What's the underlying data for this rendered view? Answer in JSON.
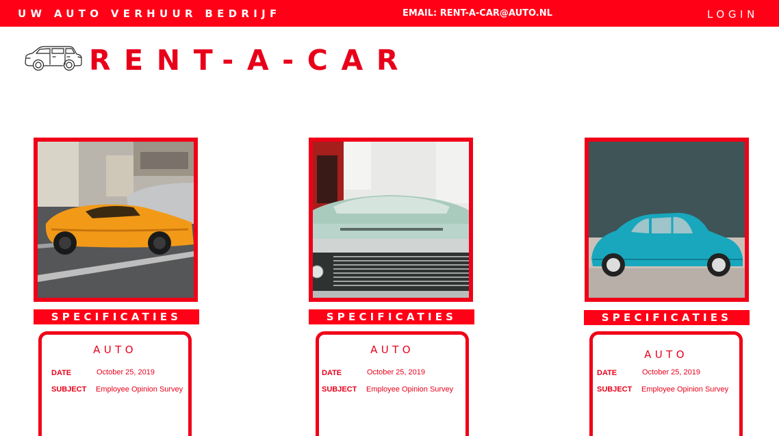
{
  "header": {
    "tagline": "UW AUTO VERHUUR BEDRIJF",
    "email": "EMAIL: RENT-A-CAR@AUTO.NL",
    "login": "LOGIN"
  },
  "brand": {
    "title": "RENT-A-CAR"
  },
  "colors": {
    "brand_red": "#ff0017",
    "text_red": "#e8001a"
  },
  "cars": [
    {
      "image": "orange sports car photo",
      "spec_title": "SPECIFICATIES",
      "card_title": "AUTO",
      "date_label": "DATE",
      "date_value": "October 25, 2019",
      "subject_label": "SUBJECT",
      "subject_value": "Employee  Opinion Survey"
    },
    {
      "image": "vintage mint car grille photo",
      "spec_title": "SPECIFICATIES",
      "card_title": "AUTO",
      "date_label": "DATE",
      "date_value": "October 25, 2019",
      "subject_label": "SUBJECT",
      "subject_value": "Employee  Opinion Survey"
    },
    {
      "image": "turquoise beetle photo",
      "spec_title": "SPECIFICATIES",
      "card_title": "AUTO",
      "date_label": "DATE",
      "date_value": "October 25, 2019",
      "subject_label": "SUBJECT",
      "subject_value": "Employee  Opinion Survey"
    }
  ]
}
